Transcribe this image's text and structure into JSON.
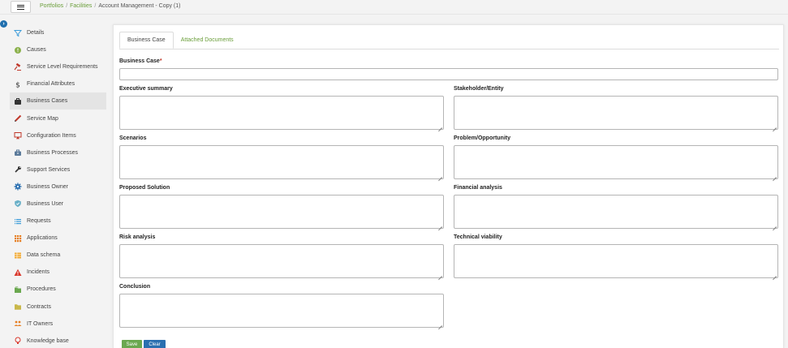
{
  "breadcrumb": {
    "items": [
      "Portfolios",
      "Facilities"
    ],
    "current": "Account Management - Copy (1)"
  },
  "sidebar": {
    "items": [
      {
        "label": "Details",
        "icon": "filter-icon",
        "color": "#3a9bd9"
      },
      {
        "label": "Causes",
        "icon": "cause-circle-icon",
        "color": "#8ab04a"
      },
      {
        "label": "Service Level Requirements",
        "icon": "gavel-icon",
        "color": "#c0392b"
      },
      {
        "label": "Financial Attributes",
        "icon": "dollar-icon",
        "color": "#333333"
      },
      {
        "label": "Business Cases",
        "icon": "briefcase-icon",
        "color": "#333333"
      },
      {
        "label": "Service Map",
        "icon": "pencil-icon",
        "color": "#c0392b"
      },
      {
        "label": "Configuration Items",
        "icon": "monitor-icon",
        "color": "#c0392b"
      },
      {
        "label": "Business Processes",
        "icon": "toolbox-icon",
        "color": "#5b7a9a"
      },
      {
        "label": "Support Services",
        "icon": "wrench-icon",
        "color": "#333333"
      },
      {
        "label": "Business Owner",
        "icon": "gear-icon",
        "color": "#2a6fb0"
      },
      {
        "label": "Business User",
        "icon": "shield-icon",
        "color": "#6ab0c8"
      },
      {
        "label": "Requests",
        "icon": "list-icon",
        "color": "#3a9bd9"
      },
      {
        "label": "Applications",
        "icon": "grid-icon",
        "color": "#e67e22"
      },
      {
        "label": "Data schema",
        "icon": "table-icon",
        "color": "#f0a830"
      },
      {
        "label": "Incidents",
        "icon": "warning-icon",
        "color": "#d9372b"
      },
      {
        "label": "Procedures",
        "icon": "folder-stack-icon",
        "color": "#6aa84f"
      },
      {
        "label": "Contracts",
        "icon": "folder-icon",
        "color": "#c9b84a"
      },
      {
        "label": "IT Owners",
        "icon": "users-icon",
        "color": "#e67e22"
      },
      {
        "label": "Knowledge base",
        "icon": "lightbulb-icon",
        "color": "#d9372b"
      }
    ],
    "active_index": 4
  },
  "tabs": [
    {
      "label": "Business Case",
      "active": true
    },
    {
      "label": "Attached Documents",
      "active": false
    }
  ],
  "form": {
    "business_case": {
      "label": "Business Case",
      "required_mark": "*",
      "value": ""
    },
    "executive_summary": {
      "label": "Executive summary",
      "value": ""
    },
    "stakeholder_entity": {
      "label": "Stakeholder/Entity",
      "value": ""
    },
    "scenarios": {
      "label": "Scenarios",
      "value": ""
    },
    "problem_opportunity": {
      "label": "Problem/Opportunity",
      "value": ""
    },
    "proposed_solution": {
      "label": "Proposed Solution",
      "value": ""
    },
    "financial_analysis": {
      "label": "Financial analysis",
      "value": ""
    },
    "risk_analysis": {
      "label": "Risk analysis",
      "value": ""
    },
    "technical_viability": {
      "label": "Technical viability",
      "value": ""
    },
    "conclusion": {
      "label": "Conclusion",
      "value": ""
    }
  },
  "buttons": {
    "save": {
      "label": "Save",
      "color": "#6aa84f"
    },
    "clear": {
      "label": "Clear",
      "color": "#2a6fb0"
    }
  },
  "colors": {
    "link_green": "#6a9e3a",
    "toggle_blue": "#1f6fae"
  }
}
